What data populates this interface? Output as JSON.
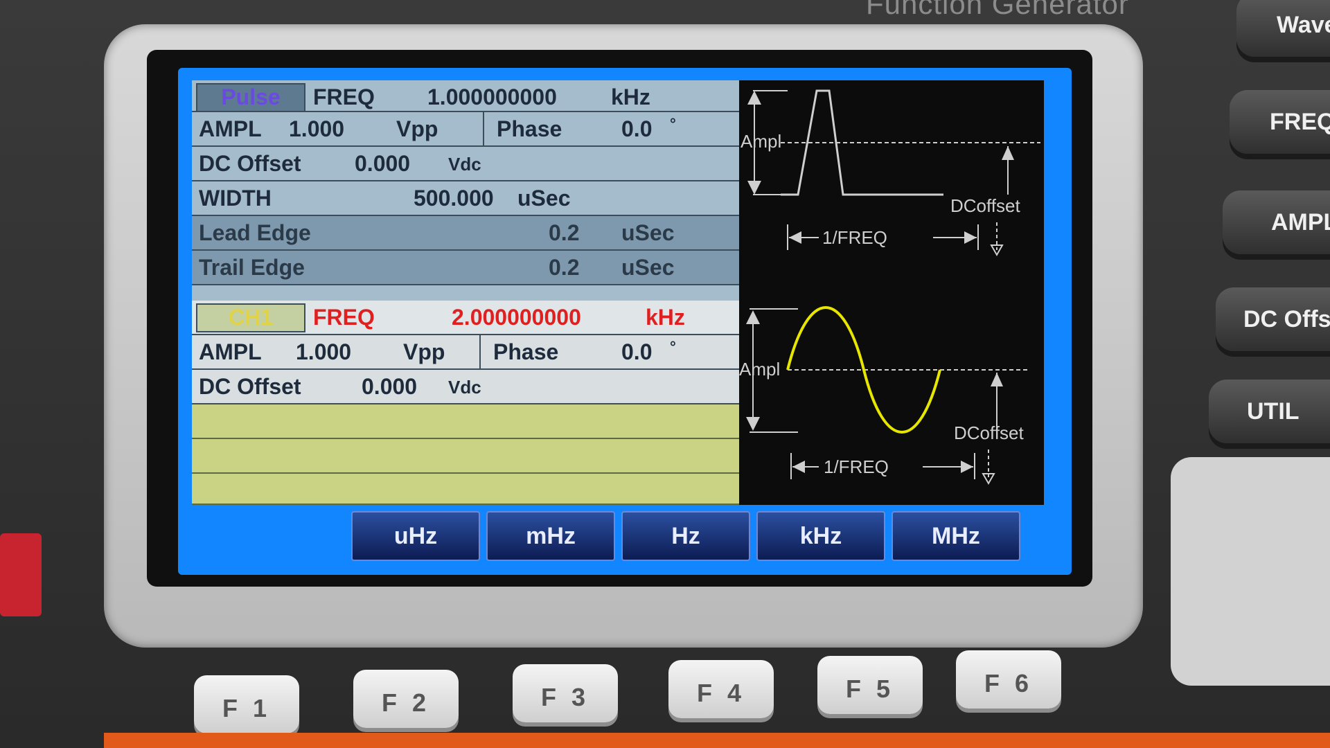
{
  "device": {
    "title": "Function Generator",
    "side_keys": [
      "Wavefo",
      "FREQ/Ra",
      "AMPL",
      "DC Offset",
      "UTIL"
    ],
    "function_keys": [
      "F 1",
      "F 2",
      "F 3",
      "F 4",
      "F 5",
      "F 6"
    ]
  },
  "pulse_panel": {
    "tag": "Pulse",
    "freq_label": "FREQ",
    "freq_value": "1.000000000",
    "freq_unit": "kHz",
    "ampl_label": "AMPL",
    "ampl_value": "1.000",
    "ampl_unit": "Vpp",
    "phase_label": "Phase",
    "phase_value": "0.0",
    "phase_unit": "°",
    "dc_label": "DC Offset",
    "dc_value": "0.000",
    "dc_unit": "Vdc",
    "width_label": "WIDTH",
    "width_value": "500.000",
    "width_unit": "uSec",
    "lead_label": "Lead Edge",
    "lead_value": "0.2",
    "lead_unit": "uSec",
    "trail_label": "Trail Edge",
    "trail_value": "0.2",
    "trail_unit": "uSec",
    "diagram": {
      "ampl_label": "Ampl",
      "dcoffset_label": "DCoffset",
      "period_label": "1/FREQ"
    }
  },
  "ch1_panel": {
    "tag": "CH1",
    "freq_label": "FREQ",
    "freq_value": "2.000000000",
    "freq_unit": "kHz",
    "ampl_label": "AMPL",
    "ampl_value": "1.000",
    "ampl_unit": "Vpp",
    "phase_label": "Phase",
    "phase_value": "0.0",
    "phase_unit": "°",
    "dc_label": "DC Offset",
    "dc_value": "0.000",
    "dc_unit": "Vdc",
    "diagram": {
      "ampl_label": "Ampl",
      "dcoffset_label": "DCoffset",
      "period_label": "1/FREQ",
      "wave_color": "#e6e600"
    }
  },
  "softkeys": [
    "uHz",
    "mHz",
    "Hz",
    "kHz",
    "MHz"
  ],
  "colors": {
    "screen_blue": "#1186ff",
    "active_value_red": "#e02020",
    "device_accent_orange": "#e25a1a"
  }
}
